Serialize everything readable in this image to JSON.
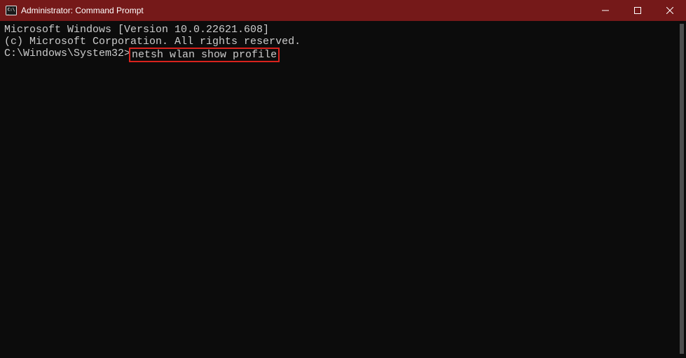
{
  "title": "Administrator: Command Prompt",
  "terminal": {
    "line1": "Microsoft Windows [Version 10.0.22621.608]",
    "line2": "(c) Microsoft Corporation. All rights reserved.",
    "blank": "",
    "prompt": "C:\\Windows\\System32>",
    "command": "netsh wlan show profile"
  }
}
